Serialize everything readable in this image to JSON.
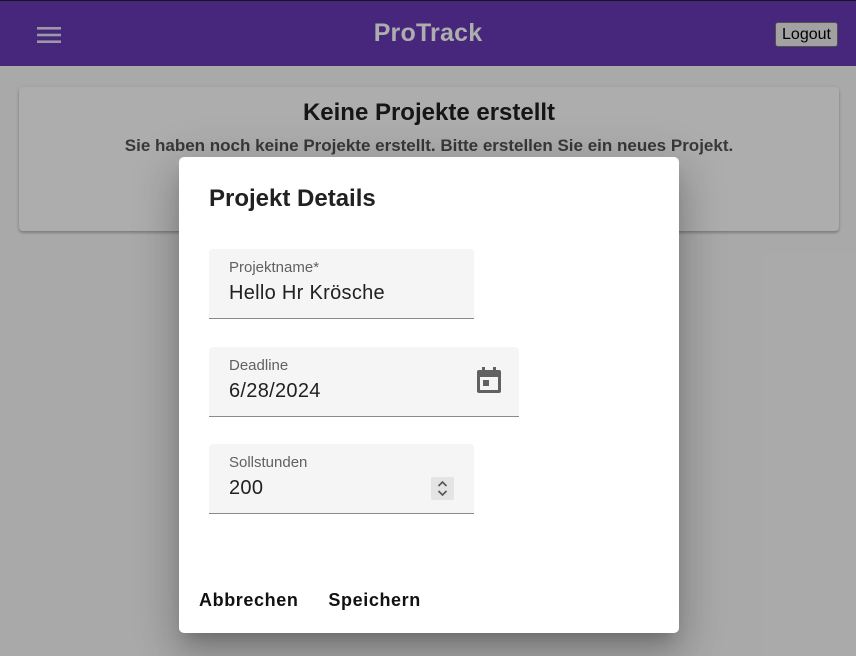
{
  "toolbar": {
    "menu_icon": "menu-icon",
    "title": "ProTrack",
    "logout_label": "Logout",
    "color": "#673ab7"
  },
  "empty_state": {
    "title": "Keine Projekte erstellt",
    "message": "Sie haben noch keine Projekte erstellt. Bitte erstellen Sie ein neues Projekt."
  },
  "dialog": {
    "title": "Projekt Details",
    "fields": {
      "name": {
        "label": "Projektname*",
        "value": "Hello Hr Krösche"
      },
      "deadline": {
        "label": "Deadline",
        "value": "6/28/2024",
        "icon": "calendar-icon"
      },
      "hours": {
        "label": "Sollstunden",
        "value": "200",
        "icon": "spinner-icon"
      }
    },
    "actions": {
      "cancel_label": "Abbrechen",
      "save_label": "Speichern"
    }
  }
}
